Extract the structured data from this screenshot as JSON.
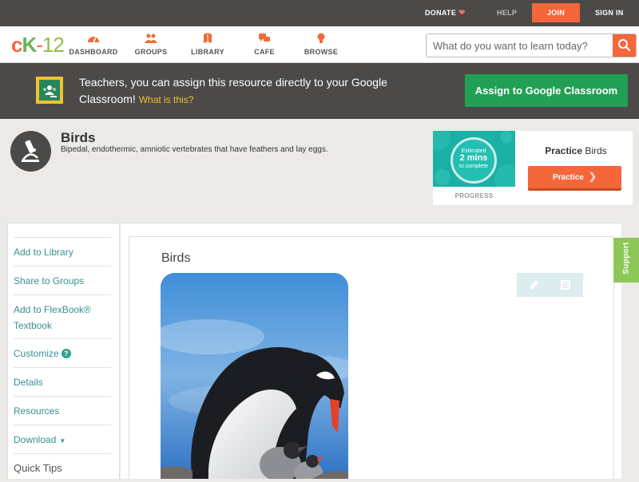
{
  "topbar": {
    "donate": "DONATE",
    "help": "HELP",
    "join": "JOIN",
    "sign_in": "SIGN IN"
  },
  "nav": {
    "logo": {
      "c": "c",
      "k": "K",
      "dash": "-",
      "num": "12"
    },
    "items": [
      {
        "label": "DASHBOARD",
        "icon": "dashboard-icon"
      },
      {
        "label": "GROUPS",
        "icon": "groups-icon"
      },
      {
        "label": "LIBRARY",
        "icon": "library-icon"
      },
      {
        "label": "CAFE",
        "icon": "cafe-icon"
      },
      {
        "label": "BROWSE",
        "icon": "browse-icon"
      }
    ],
    "search": {
      "placeholder": "What do you want to learn today?",
      "value": ""
    }
  },
  "banner": {
    "text": "Teachers, you can assign this resource directly to your Google Classroom!",
    "what_is_this": "What is this?",
    "button": "Assign to Google Classroom"
  },
  "concept": {
    "title": "Birds",
    "description": "Bipedal, endothermic, amniotic vertebrates that have feathers and lay eggs."
  },
  "practice": {
    "estimate_line1": "Estimated",
    "estimate_value": "2 mins",
    "estimate_line2": "to complete",
    "progress_label": "PROGRESS",
    "title_prefix": "Practice",
    "title_topic": "Birds",
    "button": "Practice"
  },
  "sidebar": {
    "items": [
      {
        "label": "Add to Library"
      },
      {
        "label": "Share to Groups"
      },
      {
        "label": "Add to FlexBook® Textbook"
      },
      {
        "label": "Customize"
      },
      {
        "label": "Details"
      },
      {
        "label": "Resources"
      },
      {
        "label": "Download"
      }
    ],
    "quick_tips": "Quick Tips"
  },
  "content": {
    "title": "Birds"
  },
  "support": "Support",
  "colors": {
    "accent_orange": "#f5663b",
    "classroom_green": "#21a055",
    "support_green": "#8dc758",
    "dark_bar": "#4c4a48",
    "link_teal": "#3a8f94"
  }
}
